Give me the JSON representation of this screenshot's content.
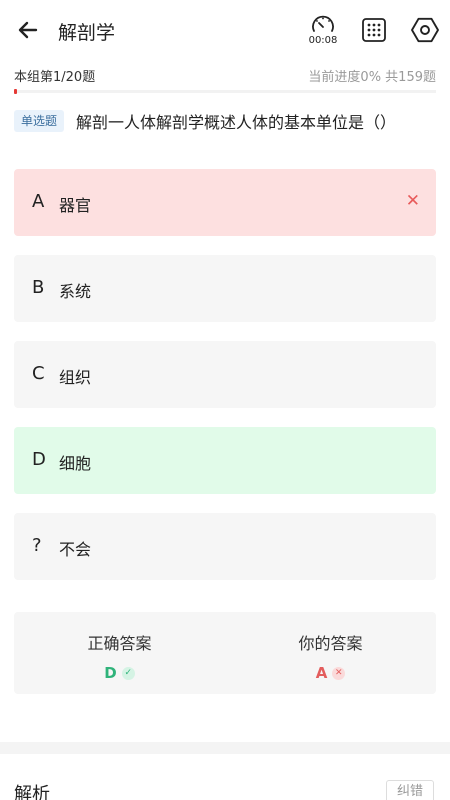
{
  "header": {
    "title": "解剖学",
    "timer": "00:08"
  },
  "progress": {
    "group_label": "本组第1/20题",
    "progress_text": "当前进度0%  共159题",
    "percent": 0
  },
  "question": {
    "type_label": "单选题",
    "text": "解剖一人体解剖学概述人体的基本单位是（）"
  },
  "options": [
    {
      "letter": "A",
      "text": "器官",
      "state": "wrong",
      "mark": "✕"
    },
    {
      "letter": "B",
      "text": "系统",
      "state": "normal",
      "mark": ""
    },
    {
      "letter": "C",
      "text": "组织",
      "state": "normal",
      "mark": ""
    },
    {
      "letter": "D",
      "text": "细胞",
      "state": "right",
      "mark": ""
    },
    {
      "letter": "?",
      "text": "不会",
      "state": "normal",
      "mark": ""
    }
  ],
  "answers": {
    "correct_label": "正确答案",
    "correct_value": "D",
    "yours_label": "你的答案",
    "yours_value": "A"
  },
  "analysis": {
    "title": "解析",
    "report_label": "纠错"
  },
  "colors": {
    "accent_red": "#e53935",
    "wrong_bg": "#fde0e0",
    "right_bg": "#e1fbe9",
    "right_text": "#2fb37a",
    "wrong_text": "#e35d5d"
  },
  "icons": [
    "back-arrow-icon",
    "timer-gauge-icon",
    "answer-grid-icon",
    "settings-hexagon-icon",
    "close-icon",
    "check-icon"
  ]
}
